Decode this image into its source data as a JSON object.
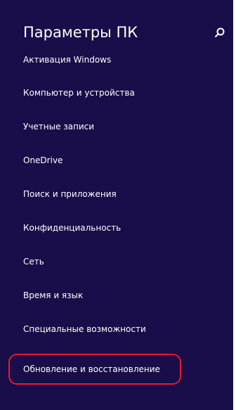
{
  "header": {
    "title": "Параметры ПК",
    "search_icon": "search-icon"
  },
  "menu": {
    "items": [
      {
        "label": "Активация Windows"
      },
      {
        "label": "Компьютер и устройства"
      },
      {
        "label": "Учетные записи"
      },
      {
        "label": "OneDrive"
      },
      {
        "label": "Поиск и приложения"
      },
      {
        "label": "Конфиденциальность"
      },
      {
        "label": "Сеть"
      },
      {
        "label": "Время и язык"
      },
      {
        "label": "Специальные возможности"
      },
      {
        "label": "Обновление и восстановление"
      }
    ],
    "highlighted_item": "Обновление и восстановление"
  },
  "colors": {
    "background": "#190e49",
    "text": "#ffffff",
    "highlight": "#e8182d"
  }
}
